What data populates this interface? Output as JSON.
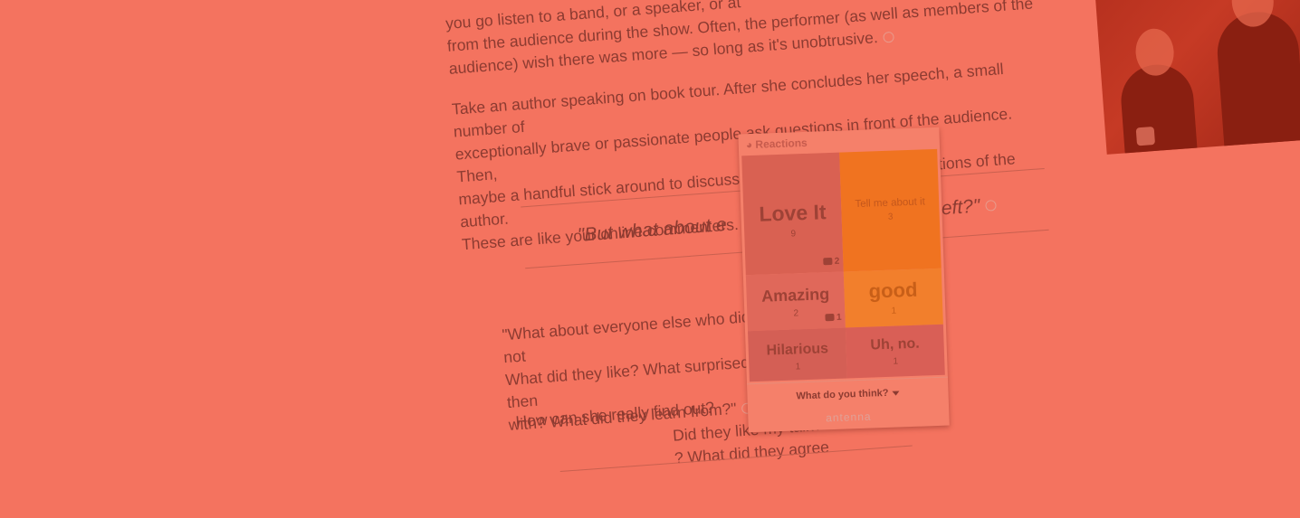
{
  "article": {
    "para1": [
      "you go listen to a band, or a speaker, or at",
      "from the audience during the show. Often, the performer (as well as members of the",
      "audience) wish there was more — so long as it's unobtrusive."
    ],
    "para2": [
      "Take an author speaking on book tour. After she concludes her speech, a small number of",
      "exceptionally brave or passionate people ask questions in front of the audience. Then,",
      "maybe a handful stick around to discuss the talk, and ask more questions of the author.",
      "These are like your online commenters."
    ],
    "pull_left": "\"But what about e",
    "pull_right": ". left?\"",
    "quote_left": [
      "\"What about everyone else who did not",
      "What did they like? What surprised then",
      "with? What did they learn from?\""
    ],
    "quote_right": [
      "Did they like my talk?",
      "? What did they agree"
    ],
    "ask": "How can she really find out?"
  },
  "widget": {
    "header": "Reactions",
    "tiles": [
      {
        "label": "Love It",
        "count": "9",
        "comments": "2"
      },
      {
        "label": "Tell me about it",
        "count": "3"
      },
      {
        "label": "Amazing",
        "count": "2",
        "comments": "1"
      },
      {
        "label": "good",
        "count": "1"
      },
      {
        "label": "Hilarious",
        "count": "1"
      },
      {
        "label": "Uh, no.",
        "count": "1"
      }
    ],
    "prompt": "What do you think?",
    "brand": "antenna"
  },
  "icons": {
    "reactions": "antenna-logo-icon",
    "comment": "comment-icon",
    "bubble": "reaction-bubble-icon",
    "caret": "caret-down-icon"
  }
}
